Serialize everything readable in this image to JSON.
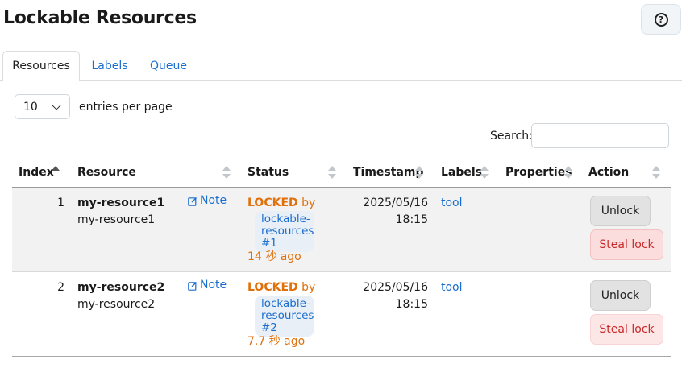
{
  "page": {
    "title": "Lockable Resources",
    "help_symbol": "?"
  },
  "tabs": [
    {
      "label": "Resources",
      "active": true
    },
    {
      "label": "Labels",
      "active": false
    },
    {
      "label": "Queue",
      "active": false
    }
  ],
  "entries": {
    "selected": "10",
    "label": "entries per page"
  },
  "search": {
    "label": "Search:",
    "value": "",
    "placeholder": ""
  },
  "table": {
    "columns": [
      "Index",
      "Resource",
      "Status",
      "Timestamp",
      "Labels",
      "Properties",
      "Action"
    ],
    "sorted_column": "Index",
    "sort_direction": "asc",
    "rows": [
      {
        "index": "1",
        "name": "my-resource1",
        "description": "my-resource1",
        "note": "Note",
        "status": "LOCKED",
        "by": "by",
        "locked_by": [
          "lockable-",
          "resources",
          "#1"
        ],
        "ago": "14 秒 ago",
        "timestamp_date": "2025/05/16",
        "timestamp_time": "18:15",
        "label": "tool",
        "unlock": "Unlock",
        "steal": "Steal lock"
      },
      {
        "index": "2",
        "name": "my-resource2",
        "description": "my-resource2",
        "note": "Note",
        "status": "LOCKED",
        "by": "by",
        "locked_by": [
          "lockable-",
          "resources",
          "#2"
        ],
        "ago": "7.7 秒 ago",
        "timestamp_date": "2025/05/16",
        "timestamp_time": "18:15",
        "label": "tool",
        "unlock": "Unlock",
        "steal": "Steal lock"
      }
    ]
  },
  "colors": {
    "link": "#1a6ecf",
    "locked": "#e0700c",
    "danger": "#c92a2a"
  }
}
